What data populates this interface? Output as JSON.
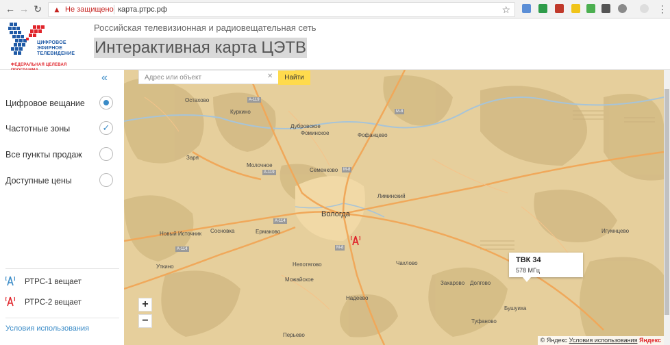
{
  "browser": {
    "not_secure": "Не защищено",
    "url": "карта.ртрс.рф"
  },
  "header": {
    "logo": {
      "line1": "ЦИФРОВОЕ",
      "line2": "ЭФИРНОЕ",
      "line3": "ТЕЛЕВИДЕНИЕ",
      "line4": "ФЕДЕРАЛЬНАЯ ЦЕЛЕВАЯ ПРОГРАММА"
    },
    "subtitle": "Российская телевизионная и радиовещательная сеть",
    "title": "Интерактивная карта ЦЭТВ"
  },
  "sidebar": {
    "collapse_icon": "double-chevron-left",
    "options": [
      {
        "label": "Цифровое вещание",
        "state": "radio-selected"
      },
      {
        "label": "Частотные зоны",
        "state": "checked"
      },
      {
        "label": "Все пункты продаж",
        "state": "unselected"
      },
      {
        "label": "Доступные цены",
        "state": "unselected"
      }
    ],
    "legend": [
      {
        "label": "РТРС-1 вещает",
        "color": "#3a8bc7"
      },
      {
        "label": "РТРС-2 вещает",
        "color": "#e0252b"
      }
    ],
    "terms": "Условия использования"
  },
  "map": {
    "search_placeholder": "Адрес или объект",
    "find_button": "Найти",
    "zoom_in": "+",
    "zoom_out": "−",
    "popup": {
      "title": "ТВК 34",
      "freq": "578 МГц"
    },
    "copyright": "© Яндекс",
    "terms_link": "Условия использования",
    "brand": "Яндекс",
    "cities": [
      "Остахово",
      "Куркино",
      "Дубровское",
      "Фоминское",
      "Фофанцево",
      "Заря",
      "Молочное",
      "Семенково",
      "Лиминский",
      "Вологда",
      "Новый Источник",
      "Сосновка",
      "Ермаково",
      "Непотягово",
      "Уткино",
      "Чахлово",
      "Захарово",
      "Долгово",
      "Игумнцево",
      "Можайское",
      "Надеево",
      "Бушуиха",
      "Туфаново",
      "Перьево"
    ],
    "highways": [
      "А-119",
      "М-8",
      "М-8",
      "А-119",
      "М-8",
      "А-114",
      "А-114",
      "М-8"
    ]
  },
  "colors": {
    "accent": "#3a8bc7",
    "map_bg": "#e6cf9c",
    "forest": "#d4bb85",
    "road": "#f0a85a",
    "yandex_button": "#ffdb4d"
  }
}
